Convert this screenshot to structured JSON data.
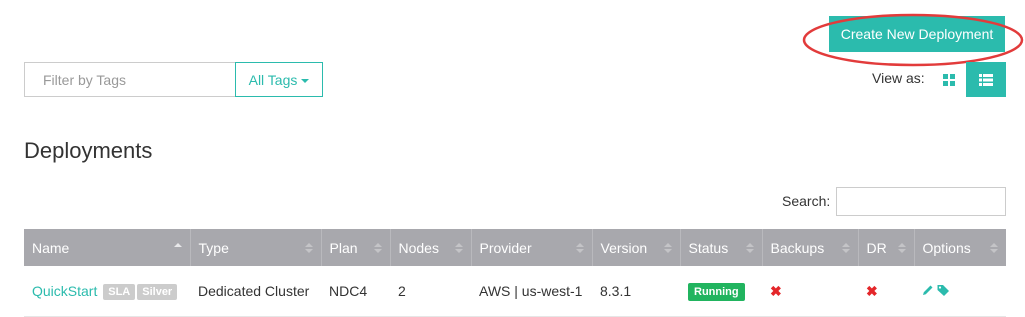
{
  "toolbar": {
    "create_label": "Create New Deployment",
    "filter_placeholder": "Filter by Tags",
    "tags_label": "All Tags",
    "view_as_label": "View as:"
  },
  "page": {
    "title": "Deployments"
  },
  "search": {
    "label": "Search:",
    "value": ""
  },
  "table": {
    "headers": [
      "Name",
      "Type",
      "Plan",
      "Nodes",
      "Provider",
      "Version",
      "Status",
      "Backups",
      "DR",
      "Options"
    ],
    "rows": [
      {
        "name": "QuickStart",
        "tags": [
          "SLA",
          "Silver"
        ],
        "type": "Dedicated Cluster",
        "plan": "NDC4",
        "nodes": "2",
        "provider": "AWS | us-west-1",
        "version": "8.3.1",
        "status": "Running",
        "backups": "✖",
        "dr": "✖"
      }
    ]
  },
  "colors": {
    "accent": "#2bbbad",
    "header_bg": "#a8a8ad",
    "running": "#21b45f",
    "no": "#e4262a",
    "highlight": "#e23b3b"
  },
  "icons": {
    "view_grid": "grid-icon",
    "view_list": "list-icon",
    "options": [
      "pencil-icon",
      "tag-icon"
    ]
  }
}
